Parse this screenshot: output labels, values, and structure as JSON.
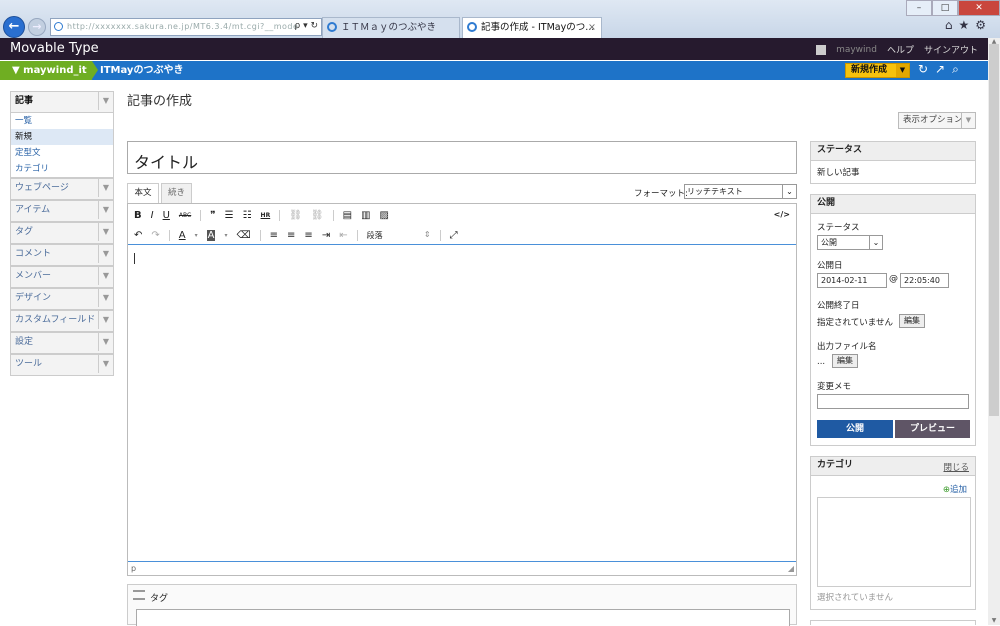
{
  "browser": {
    "address_text": "http://xxxxxxx.sakura.ne.jp/MT6.3.4/mt.cgi?__mode",
    "address_icons": "ρ ▾ ↻",
    "tabs": [
      {
        "label": "ＩＴＭａｙのつぶやき"
      },
      {
        "label": "記事の作成 - ITMayのつ..."
      }
    ],
    "tab_close": "×",
    "window_buttons": {
      "minimize": "–",
      "maximize": "□",
      "close": "✕"
    },
    "toolbar_icons": "⌂★⚙"
  },
  "header": {
    "brand": "Movable Type",
    "username": "maywind",
    "help": "ヘルプ",
    "signout": "サインアウト"
  },
  "blogbar": {
    "site": "maywind_it",
    "blog": "ITMayのつぶやき",
    "new_button": "新規作成",
    "icons": "↻↗⌕"
  },
  "sidebar": {
    "sections": [
      {
        "label": "記事",
        "items": [
          "一覧",
          "新規",
          "定型文",
          "カテゴリ"
        ]
      },
      {
        "label": "ウェブページ"
      },
      {
        "label": "アイテム"
      },
      {
        "label": "タグ"
      },
      {
        "label": "コメント"
      },
      {
        "label": "メンバー"
      },
      {
        "label": "デザイン"
      },
      {
        "label": "カスタムフィールド"
      },
      {
        "label": "設定"
      },
      {
        "label": "ツール"
      }
    ]
  },
  "main": {
    "page_title": "記事の作成",
    "display_options": "表示オプション",
    "title_value": "タイトル",
    "editor_tabs": [
      "本文",
      "続き"
    ],
    "format_label": "フォーマット:",
    "format_value": "リッチテキスト",
    "toolbar_row1": [
      "B",
      "I",
      "U",
      "ABC",
      "❞",
      "☰",
      "☷",
      "HR",
      "⛓",
      "⛓",
      "▤",
      "▥",
      "▨"
    ],
    "toolbar_row2": [
      "↶",
      "↷",
      "A",
      "▾",
      "A",
      "▾",
      "⌫",
      "≡",
      "≡",
      "≡",
      "⇥",
      "⇤"
    ],
    "source_icon": "</>",
    "paragraph_select": "段落",
    "path_label": "p",
    "tag_label": "タグ"
  },
  "status_panel": {
    "title": "ステータス",
    "value": "新しい記事"
  },
  "publish_panel": {
    "title": "公開",
    "status_label": "ステータス",
    "status_value": "公開",
    "date_label": "公開日",
    "date_value": "2014-02-11",
    "at": "@",
    "time_value": "22:05:40",
    "end_label": "公開終了日",
    "end_value": "指定されていません",
    "edit1": "編集",
    "filename_label": "出力ファイル名",
    "filename_value": "...",
    "edit2": "編集",
    "memo_label": "変更メモ",
    "publish_button": "公開",
    "preview_button": "プレビュー"
  },
  "category_panel": {
    "title": "カテゴリ",
    "close": "閉じる",
    "add": "追加",
    "none": "選択されていません"
  }
}
